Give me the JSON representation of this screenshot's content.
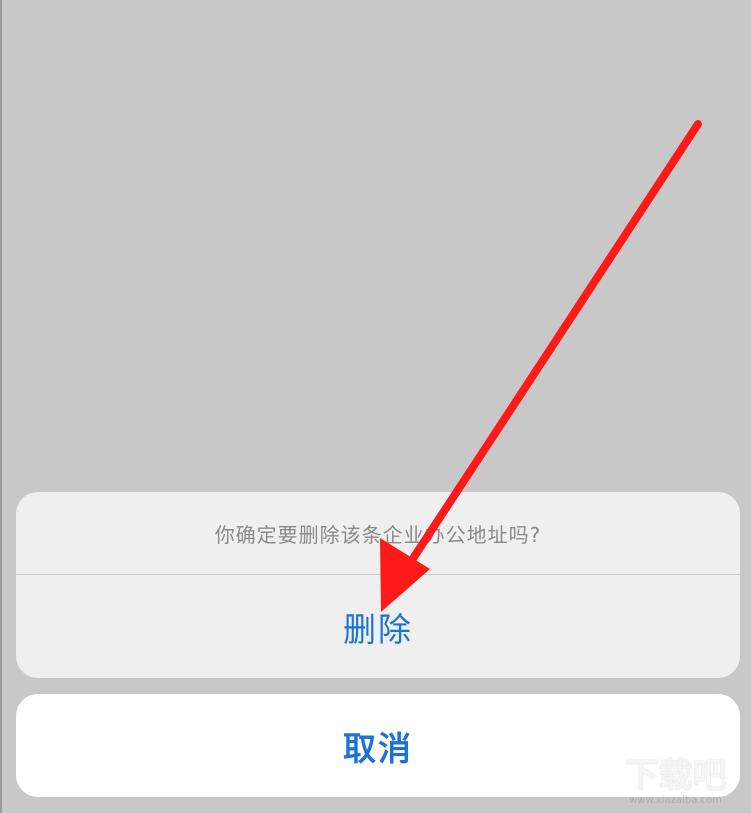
{
  "action_sheet": {
    "message": "你确定要删除该条企业办公地址吗?",
    "delete_label": "删除",
    "cancel_label": "取消"
  },
  "annotation": {
    "arrow_color": "#ff1a1a"
  },
  "watermark": {
    "logo_text": "下载吧",
    "url_text": "www.xiazaiba.com"
  },
  "colors": {
    "background": "#c8c8c8",
    "sheet_bg": "#efefef",
    "action_blue": "#1b73d6",
    "message_gray": "#8a8a8a"
  }
}
